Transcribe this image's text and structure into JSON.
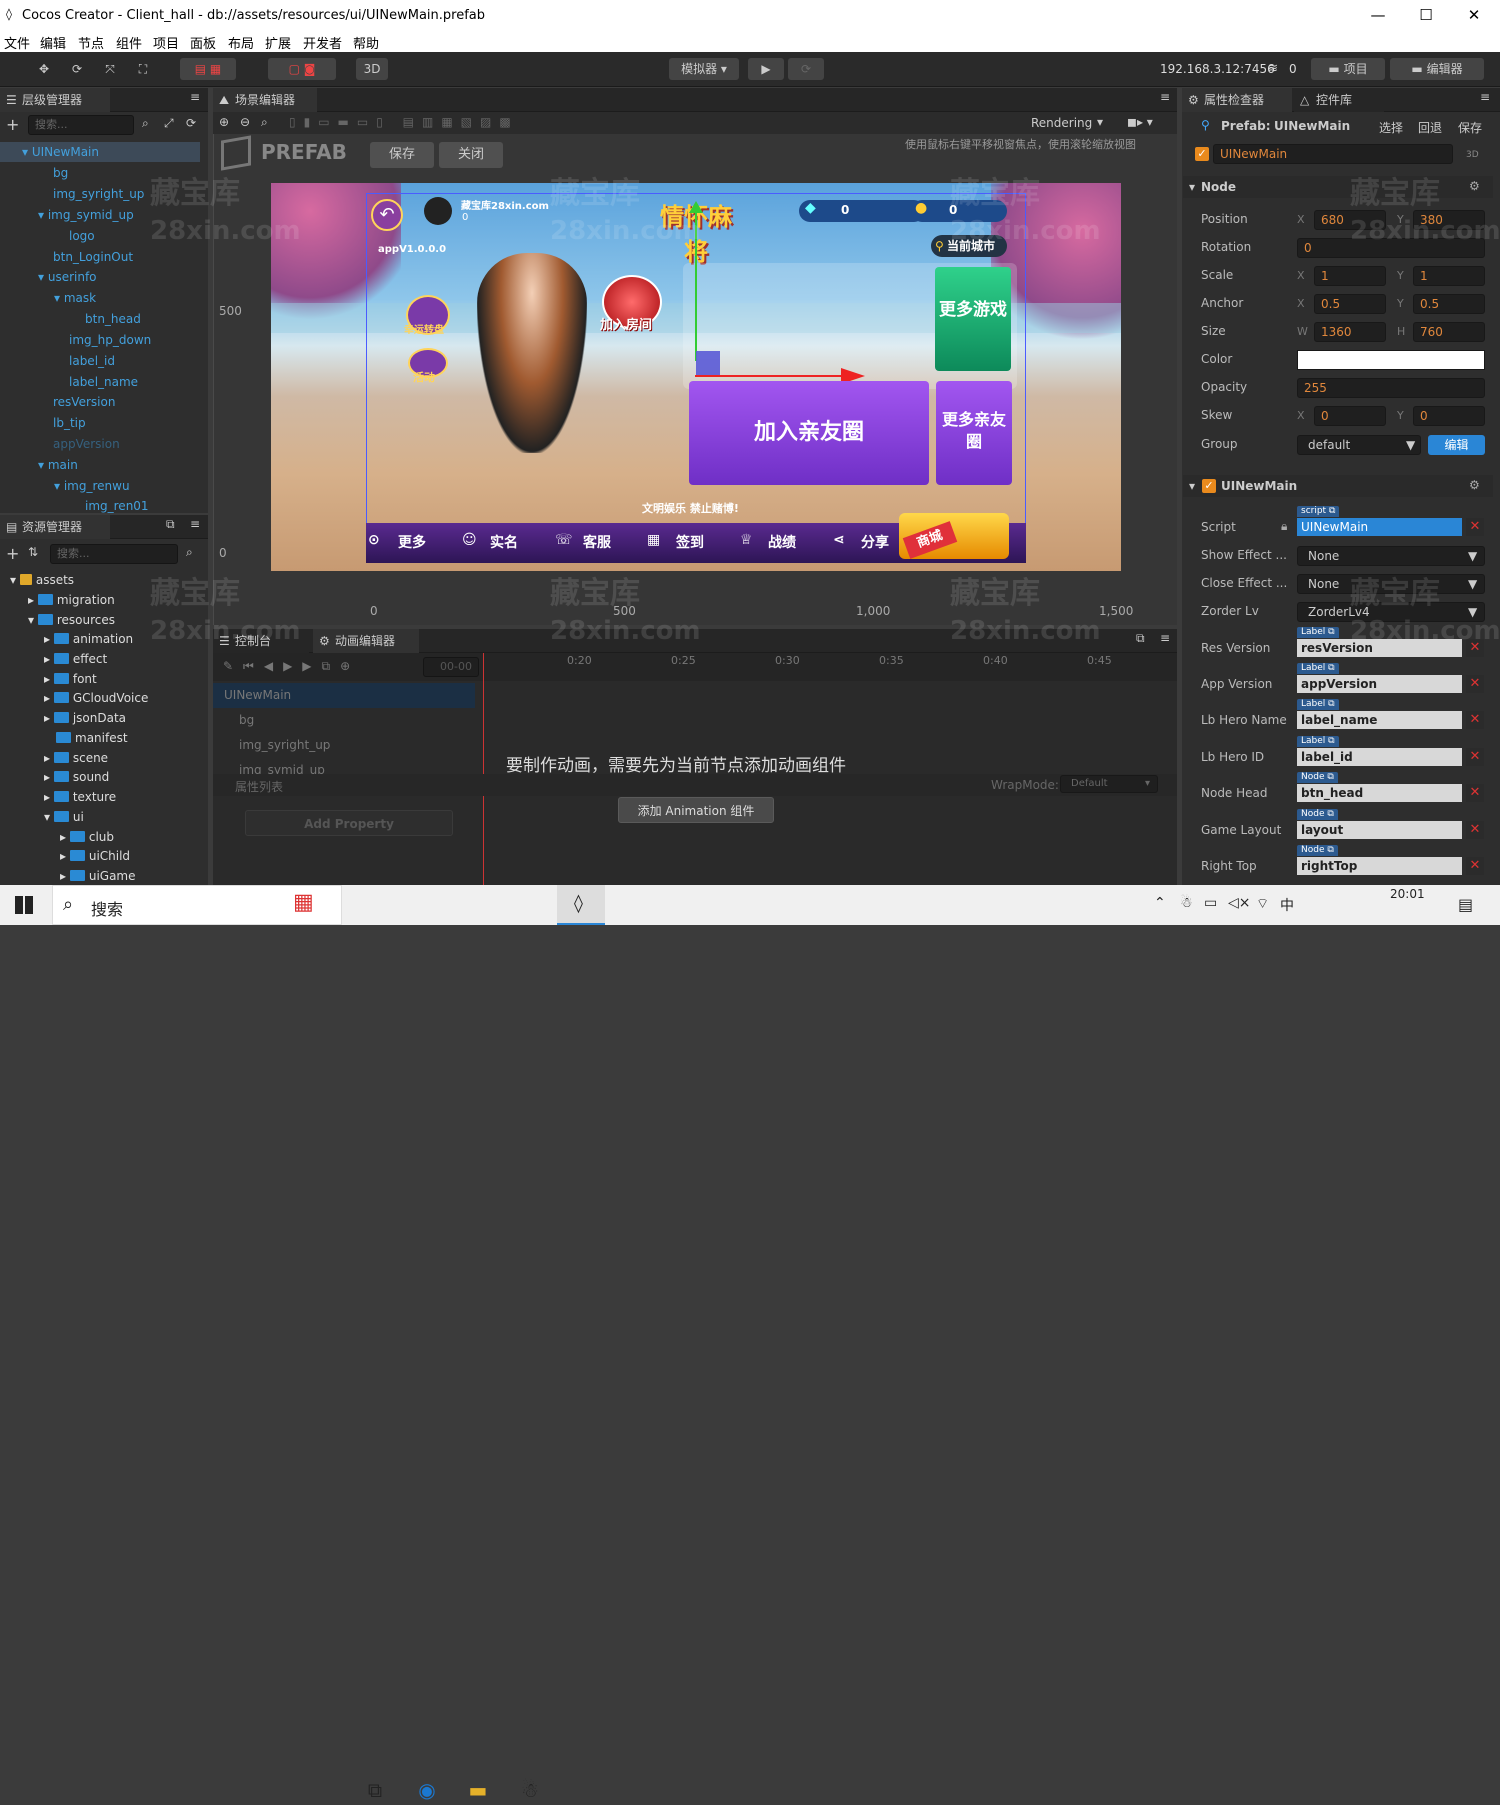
{
  "window": {
    "title": "Cocos Creator - Client_hall - db://assets/resources/ui/UINewMain.prefab"
  },
  "menu": [
    "文件",
    "编辑",
    "节点",
    "组件",
    "项目",
    "面板",
    "布局",
    "扩展",
    "开发者",
    "帮助"
  ],
  "toolbar": {
    "mode_3d": "3D",
    "simulator": "模拟器 ▾",
    "ip": "192.168.3.12:7456",
    "wifi_count": "0",
    "project_btn": "项目",
    "editor_btn": "编辑器"
  },
  "hierarchy": {
    "tab": "层级管理器",
    "search_placeholder": "搜索...",
    "nodes": [
      "UINewMain",
      "bg",
      "img_syright_up",
      "img_symid_up",
      "logo",
      "btn_LoginOut",
      "userinfo",
      "mask",
      "btn_head",
      "img_hp_down",
      "label_id",
      "label_name",
      "resVersion",
      "lb_tip",
      "appVersion",
      "main",
      "img_renwu",
      "img_ren01"
    ]
  },
  "assets": {
    "tab": "资源管理器",
    "search_placeholder": "搜索...",
    "items": [
      "assets",
      "migration",
      "resources",
      "animation",
      "effect",
      "font",
      "GCloudVoice",
      "jsonData",
      "manifest",
      "scene",
      "sound",
      "texture",
      "ui",
      "club",
      "uiChild",
      "uiGame"
    ]
  },
  "scene": {
    "tab": "场景编辑器",
    "rendering": "Rendering",
    "prefab_label": "PREFAB",
    "save_btn": "保存",
    "close_btn": "关闭",
    "hint": "使用鼠标右键平移视窗焦点，使用滚轮缩放视图",
    "ruler_y": [
      "500",
      "0"
    ],
    "ruler_x": [
      "0",
      "500",
      "1,000",
      "1,500"
    ],
    "game": {
      "username": "藏宝库28xin.com",
      "user_score": "0",
      "app_version": "appV1.0.0.0",
      "diamond": "0",
      "gold": "0",
      "city": "当前城市",
      "logo_text": "情怀麻将",
      "lucky": "幸运转盘",
      "activity": "活动",
      "join_room": "加入房间",
      "more_games": "更多游戏",
      "join_club": "加入亲友圈",
      "more_club": "更多亲友圈",
      "notice": "文明娱乐 禁止赌博!",
      "bottom_menu": [
        "更多",
        "实名",
        "客服",
        "签到",
        "战绩",
        "分享"
      ],
      "shop": "商城"
    }
  },
  "console": {
    "tabs": [
      "控制台",
      "动画编辑器"
    ],
    "time": "00-00",
    "timeline": [
      "0:20",
      "0:25",
      "0:30",
      "0:35",
      "0:40",
      "0:45"
    ],
    "nodes": [
      "UINewMain",
      "bg",
      "img_syright_up",
      "img_symid_up"
    ],
    "message": "要制作动画，需要先为当前节点添加动画组件",
    "props_label": "属性列表",
    "wrapmode_label": "WrapMode:",
    "wrapmode": "Default",
    "add_property": "Add Property",
    "add_animation": "添加 Animation 组件"
  },
  "inspector": {
    "tabs": [
      "属性检查器",
      "控件库"
    ],
    "prefab_label": "Prefab:",
    "prefab_name": "UINewMain",
    "prefab_actions": [
      "选择",
      "回退",
      "保存"
    ],
    "node_name": "UINewMain",
    "node_3d": "3D",
    "node_section": "Node",
    "position": {
      "label": "Position",
      "x": "680",
      "y": "380"
    },
    "rotation": {
      "label": "Rotation",
      "value": "0"
    },
    "scale": {
      "label": "Scale",
      "x": "1",
      "y": "1"
    },
    "anchor": {
      "label": "Anchor",
      "x": "0.5",
      "y": "0.5"
    },
    "size": {
      "label": "Size",
      "w": "1360",
      "h": "760"
    },
    "color": {
      "label": "Color",
      "value": "#ffffff"
    },
    "opacity": {
      "label": "Opacity",
      "value": "255"
    },
    "skew": {
      "label": "Skew",
      "x": "0",
      "y": "0"
    },
    "group": {
      "label": "Group",
      "value": "default",
      "edit": "编辑"
    },
    "component": "UINewMain",
    "script": {
      "label": "Script",
      "tag": "script",
      "value": "UINewMain"
    },
    "show_effect": {
      "label": "Show Effect ...",
      "value": "None"
    },
    "close_effect": {
      "label": "Close Effect ...",
      "value": "None"
    },
    "zorder": {
      "label": "Zorder Lv",
      "value": "ZorderLv4"
    },
    "refs": [
      {
        "label": "Res Version",
        "tag": "Label",
        "value": "resVersion"
      },
      {
        "label": "App Version",
        "tag": "Label",
        "value": "appVersion"
      },
      {
        "label": "Lb Hero Name",
        "tag": "Label",
        "value": "label_name"
      },
      {
        "label": "Lb Hero ID",
        "tag": "Label",
        "value": "label_id"
      },
      {
        "label": "Node Head",
        "tag": "Node",
        "value": "btn_head"
      },
      {
        "label": "Game Layout",
        "tag": "Node",
        "value": "layout"
      },
      {
        "label": "Right Top",
        "tag": "Node",
        "value": "rightTop"
      }
    ]
  },
  "taskbar": {
    "search": "搜索",
    "time": "20:01",
    "ime": "中"
  },
  "watermark": [
    "藏宝库",
    "28xin.com"
  ]
}
